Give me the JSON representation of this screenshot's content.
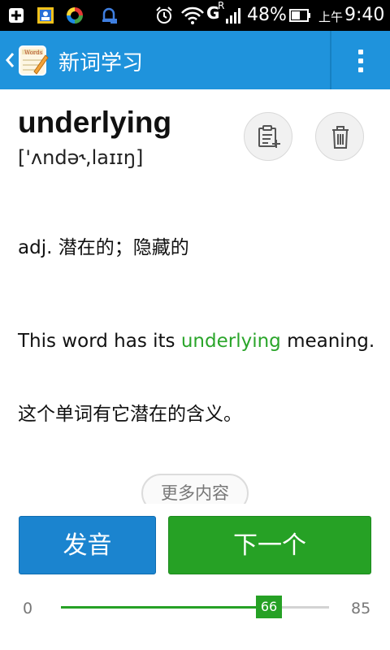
{
  "status_bar": {
    "net_type": "G",
    "roaming": "R",
    "battery_percent": "48%",
    "am_pm": "上午",
    "time": "9:40"
  },
  "header": {
    "title": "新词学习",
    "logo_text": "Words"
  },
  "word": {
    "text": "underlying",
    "phonetic": "['ʌndə˞,laɪɪŋ]"
  },
  "definition": "adj. 潜在的；隐藏的",
  "example": {
    "before": "This word has its ",
    "highlight": "underlying",
    "after": " meaning.",
    "translation": "这个单词有它潜在的含义。"
  },
  "more_label": "更多内容",
  "buttons": {
    "pronounce": "发音",
    "next": "下一个"
  },
  "progress": {
    "min": "0",
    "max": "85",
    "value": "66",
    "fraction": 0.7765
  },
  "colors": {
    "action_bar": "#1f93dc",
    "accent_green": "#26a125",
    "button_blue": "#1b84cf"
  },
  "icons": {
    "add_to_list": "add-to-list-icon",
    "delete": "trash-icon",
    "overflow": "overflow-menu-icon"
  }
}
